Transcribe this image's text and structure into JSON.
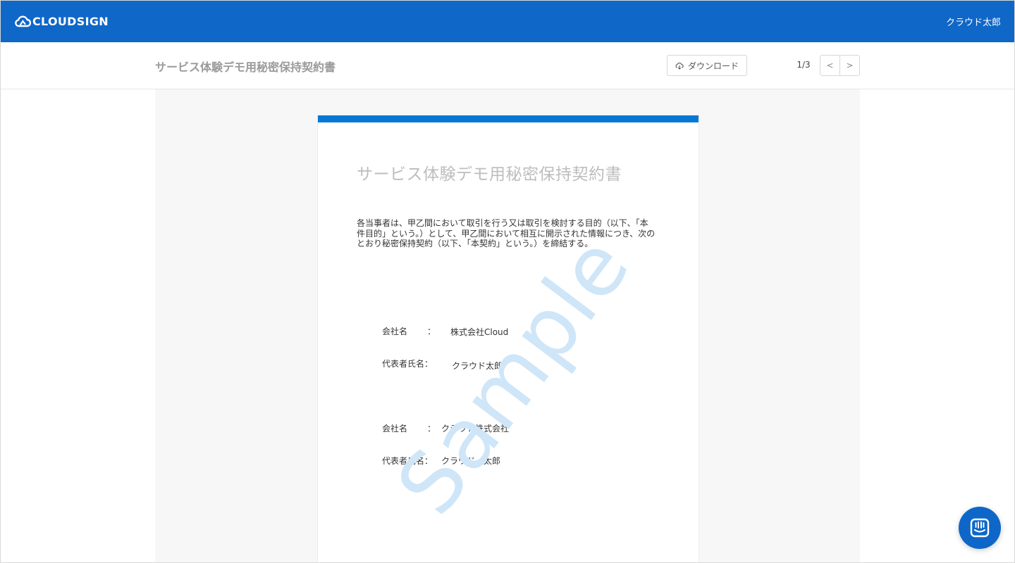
{
  "header": {
    "logo_text": "CLOUDSIGN",
    "user_name": "クラウド太郎",
    "brand_color": "#0f67c8"
  },
  "toolbar": {
    "doc_title": "サービス体験デモ用秘密保持契約書",
    "download_label": "ダウンロード",
    "download_icon": "cloud-download-icon",
    "page_indicator": "1/3",
    "prev_label": "<",
    "next_label": ">"
  },
  "document": {
    "title": "サービス体験デモ用秘密保持契約書",
    "preamble": "各当事者は、甲乙間において取引を行う又は取引を検討する目的（以下、「本件目的」という。）として、甲乙間において相互に開示された情報につき、次のとおり秘密保持契約（以下、「本契約」という。）を締結する。",
    "watermark": "Sample",
    "accent_color": "#0678d4",
    "party1": {
      "company_label": "会社名",
      "company_colon": "：",
      "company_value": "株式会社Cloud",
      "rep_label": "代表者氏名：",
      "rep_value": "クラウド太郎"
    },
    "party2": {
      "company_label": "会社名",
      "company_colon": "：",
      "company_value": "クラウド株式会社",
      "rep_label": "代表者氏名：",
      "rep_value": "クラウド　太郎"
    }
  },
  "chat": {
    "icon": "chat-icon"
  }
}
